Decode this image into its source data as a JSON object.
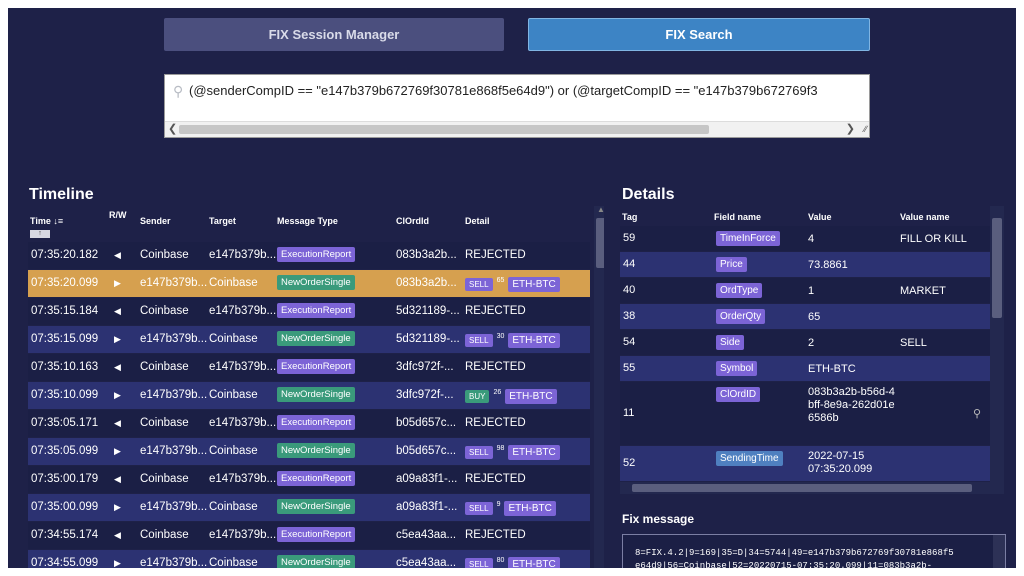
{
  "nav": {
    "session_label": "FIX Session Manager",
    "search_label": "FIX Search"
  },
  "search": {
    "query": "(@senderCompID == \"e147b379b672769f30781e868f5e64d9\") or (@targetCompID == \"e147b379b672769f3"
  },
  "timeline": {
    "title": "Timeline",
    "columns": {
      "time": "Time",
      "rw": "R/W",
      "sender": "Sender",
      "target": "Target",
      "msg_type": "Message Type",
      "clordid": "ClOrdId",
      "detail": "Detail"
    },
    "rows": [
      {
        "time": "07:35:20.182",
        "rw": "◀",
        "sender": "Coinbase",
        "target": "e147b379b...",
        "msg": "ExecutionReport",
        "msg_kind": "exec",
        "clordid": "083b3a2b...",
        "detail_text": "REJECTED"
      },
      {
        "time": "07:35:20.099",
        "rw": "▶",
        "sender": "e147b379b...",
        "target": "Coinbase",
        "msg": "NewOrderSingle",
        "msg_kind": "new",
        "clordid": "083b3a2b...",
        "side": "SELL",
        "qty": "65",
        "symbol": "ETH-BTC",
        "selected": true
      },
      {
        "time": "07:35:15.184",
        "rw": "◀",
        "sender": "Coinbase",
        "target": "e147b379b...",
        "msg": "ExecutionReport",
        "msg_kind": "exec",
        "clordid": "5d321189-...",
        "detail_text": "REJECTED"
      },
      {
        "time": "07:35:15.099",
        "rw": "▶",
        "sender": "e147b379b...",
        "target": "Coinbase",
        "msg": "NewOrderSingle",
        "msg_kind": "new",
        "clordid": "5d321189-...",
        "side": "SELL",
        "qty": "30",
        "symbol": "ETH-BTC"
      },
      {
        "time": "07:35:10.163",
        "rw": "◀",
        "sender": "Coinbase",
        "target": "e147b379b...",
        "msg": "ExecutionReport",
        "msg_kind": "exec",
        "clordid": "3dfc972f-...",
        "detail_text": "REJECTED"
      },
      {
        "time": "07:35:10.099",
        "rw": "▶",
        "sender": "e147b379b...",
        "target": "Coinbase",
        "msg": "NewOrderSingle",
        "msg_kind": "new",
        "clordid": "3dfc972f-...",
        "side": "BUY",
        "qty": "26",
        "symbol": "ETH-BTC"
      },
      {
        "time": "07:35:05.171",
        "rw": "◀",
        "sender": "Coinbase",
        "target": "e147b379b...",
        "msg": "ExecutionReport",
        "msg_kind": "exec",
        "clordid": "b05d657c...",
        "detail_text": "REJECTED"
      },
      {
        "time": "07:35:05.099",
        "rw": "▶",
        "sender": "e147b379b...",
        "target": "Coinbase",
        "msg": "NewOrderSingle",
        "msg_kind": "new",
        "clordid": "b05d657c...",
        "side": "SELL",
        "qty": "98",
        "symbol": "ETH-BTC"
      },
      {
        "time": "07:35:00.179",
        "rw": "◀",
        "sender": "Coinbase",
        "target": "e147b379b...",
        "msg": "ExecutionReport",
        "msg_kind": "exec",
        "clordid": "a09a83f1-...",
        "detail_text": "REJECTED"
      },
      {
        "time": "07:35:00.099",
        "rw": "▶",
        "sender": "e147b379b...",
        "target": "Coinbase",
        "msg": "NewOrderSingle",
        "msg_kind": "new",
        "clordid": "a09a83f1-...",
        "side": "SELL",
        "qty": "9",
        "symbol": "ETH-BTC"
      },
      {
        "time": "07:34:55.174",
        "rw": "◀",
        "sender": "Coinbase",
        "target": "e147b379b...",
        "msg": "ExecutionReport",
        "msg_kind": "exec",
        "clordid": "c5ea43aa...",
        "detail_text": "REJECTED"
      },
      {
        "time": "07:34:55.099",
        "rw": "▶",
        "sender": "e147b379b...",
        "target": "Coinbase",
        "msg": "NewOrderSingle",
        "msg_kind": "new",
        "clordid": "c5ea43aa...",
        "side": "SELL",
        "qty": "80",
        "symbol": "ETH-BTC"
      }
    ]
  },
  "details": {
    "title": "Details",
    "columns": {
      "tag": "Tag",
      "field": "Field name",
      "value": "Value",
      "vname": "Value name"
    },
    "rows": [
      {
        "tag": "59",
        "field": "TimeInForce",
        "value": "4",
        "vname": "FILL OR KILL"
      },
      {
        "tag": "44",
        "field": "Price",
        "value": "73.8861",
        "vname": ""
      },
      {
        "tag": "40",
        "field": "OrdType",
        "value": "1",
        "vname": "MARKET"
      },
      {
        "tag": "38",
        "field": "OrderQty",
        "value": "65",
        "vname": ""
      },
      {
        "tag": "54",
        "field": "Side",
        "value": "2",
        "vname": "SELL"
      },
      {
        "tag": "55",
        "field": "Symbol",
        "value": "ETH-BTC",
        "vname": ""
      },
      {
        "tag": "11",
        "field": "ClOrdID",
        "value": "083b3a2b-b56d-4bff-8e9a-262d01e6586b",
        "vname": "",
        "searchable": true
      },
      {
        "tag": "52",
        "field": "SendingTime",
        "value": "2022-07-15 07:35:20.099",
        "vname": "",
        "blue": true
      }
    ]
  },
  "fix": {
    "title": "Fix message",
    "line1": "8=FIX.4.2|9=169|35=D|34=5744|49=e147b379b672769f30781e868f5",
    "line2": "e64d9|56=Coinbase|52=20220715-07:35:20.099|11=083b3a2b-"
  },
  "colors": {
    "background": "#1e2148",
    "selected_row": "#d6a04f",
    "exec_badge": "#7c64d6",
    "new_badge": "#3a9a7b",
    "active_tab": "#3d84c5"
  }
}
